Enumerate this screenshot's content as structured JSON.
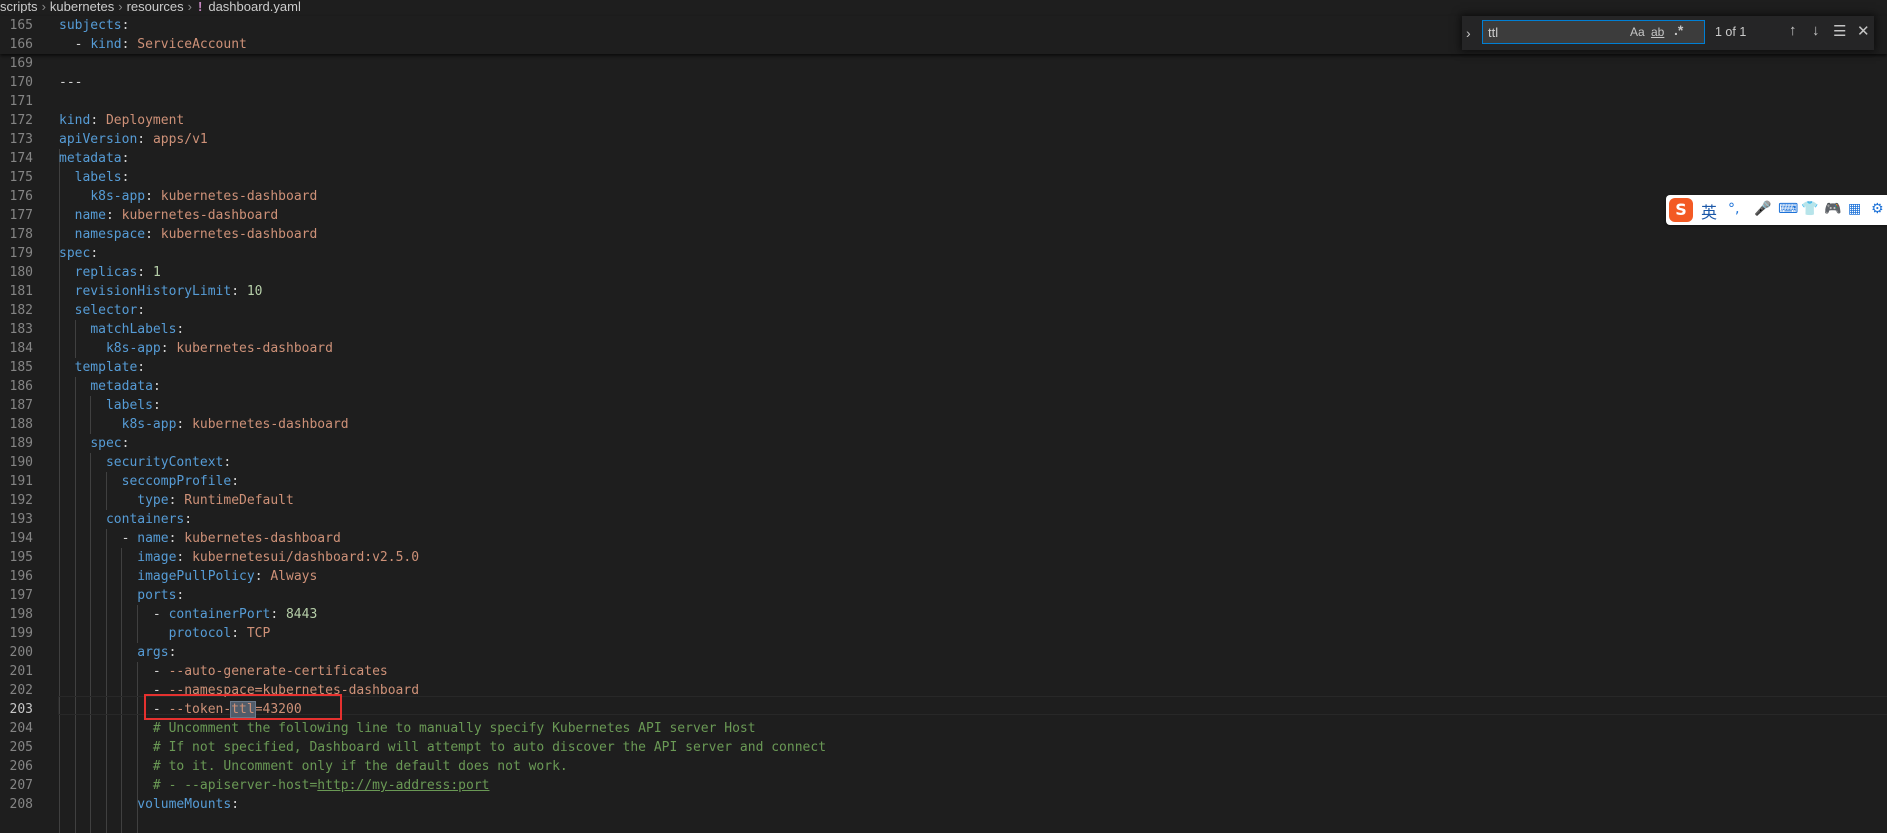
{
  "breadcrumb": {
    "parts": [
      "scripts",
      "kubernetes",
      "resources"
    ],
    "file_icon": "!",
    "file": "dashboard.yaml"
  },
  "find_widget": {
    "query": "ttl",
    "match_case_label": "Aa",
    "whole_word_label": "ab",
    "regex_label": ".*",
    "count": "1 of 1",
    "icons": [
      "chevron-right-icon",
      "arrow-up-icon",
      "arrow-down-icon",
      "find-in-selection-icon",
      "close-icon"
    ]
  },
  "ime_toolbar": {
    "logo": "S",
    "language": "英",
    "icons": [
      "punctuation-icon",
      "microphone-icon",
      "keyboard-icon",
      "skin-icon",
      "gamepad-icon",
      "grid-icon",
      "settings-icon"
    ]
  },
  "sticky": [
    {
      "num": "165",
      "tokens": [
        [
          "k",
          "subjects"
        ],
        [
          "p",
          ":"
        ]
      ]
    },
    {
      "num": "166",
      "tokens": [
        [
          "p",
          "  - "
        ],
        [
          "k",
          "kind"
        ],
        [
          "p",
          ": "
        ],
        [
          "s",
          "ServiceAccount"
        ]
      ]
    }
  ],
  "lines": [
    {
      "num": "169",
      "tokens": []
    },
    {
      "num": "170",
      "tokens": [
        [
          "p",
          "---"
        ]
      ]
    },
    {
      "num": "171",
      "tokens": []
    },
    {
      "num": "172",
      "tokens": [
        [
          "k",
          "kind"
        ],
        [
          "p",
          ": "
        ],
        [
          "s",
          "Deployment"
        ]
      ]
    },
    {
      "num": "173",
      "tokens": [
        [
          "k",
          "apiVersion"
        ],
        [
          "p",
          ": "
        ],
        [
          "s",
          "apps/v1"
        ]
      ]
    },
    {
      "num": "174",
      "tokens": [
        [
          "k",
          "metadata"
        ],
        [
          "p",
          ":"
        ]
      ]
    },
    {
      "num": "175",
      "tokens": [
        [
          "p",
          "  "
        ],
        [
          "k",
          "labels"
        ],
        [
          "p",
          ":"
        ]
      ]
    },
    {
      "num": "176",
      "tokens": [
        [
          "p",
          "    "
        ],
        [
          "k",
          "k8s-app"
        ],
        [
          "p",
          ": "
        ],
        [
          "s",
          "kubernetes-dashboard"
        ]
      ]
    },
    {
      "num": "177",
      "tokens": [
        [
          "p",
          "  "
        ],
        [
          "k",
          "name"
        ],
        [
          "p",
          ": "
        ],
        [
          "s",
          "kubernetes-dashboard"
        ]
      ]
    },
    {
      "num": "178",
      "tokens": [
        [
          "p",
          "  "
        ],
        [
          "k",
          "namespace"
        ],
        [
          "p",
          ": "
        ],
        [
          "s",
          "kubernetes-dashboard"
        ]
      ]
    },
    {
      "num": "179",
      "tokens": [
        [
          "k",
          "spec"
        ],
        [
          "p",
          ":"
        ]
      ]
    },
    {
      "num": "180",
      "tokens": [
        [
          "p",
          "  "
        ],
        [
          "k",
          "replicas"
        ],
        [
          "p",
          ": "
        ],
        [
          "n",
          "1"
        ]
      ]
    },
    {
      "num": "181",
      "tokens": [
        [
          "p",
          "  "
        ],
        [
          "k",
          "revisionHistoryLimit"
        ],
        [
          "p",
          ": "
        ],
        [
          "n",
          "10"
        ]
      ]
    },
    {
      "num": "182",
      "tokens": [
        [
          "p",
          "  "
        ],
        [
          "k",
          "selector"
        ],
        [
          "p",
          ":"
        ]
      ]
    },
    {
      "num": "183",
      "tokens": [
        [
          "p",
          "    "
        ],
        [
          "k",
          "matchLabels"
        ],
        [
          "p",
          ":"
        ]
      ]
    },
    {
      "num": "184",
      "tokens": [
        [
          "p",
          "      "
        ],
        [
          "k",
          "k8s-app"
        ],
        [
          "p",
          ": "
        ],
        [
          "s",
          "kubernetes-dashboard"
        ]
      ]
    },
    {
      "num": "185",
      "tokens": [
        [
          "p",
          "  "
        ],
        [
          "k",
          "template"
        ],
        [
          "p",
          ":"
        ]
      ]
    },
    {
      "num": "186",
      "tokens": [
        [
          "p",
          "    "
        ],
        [
          "k",
          "metadata"
        ],
        [
          "p",
          ":"
        ]
      ]
    },
    {
      "num": "187",
      "tokens": [
        [
          "p",
          "      "
        ],
        [
          "k",
          "labels"
        ],
        [
          "p",
          ":"
        ]
      ]
    },
    {
      "num": "188",
      "tokens": [
        [
          "p",
          "        "
        ],
        [
          "k",
          "k8s-app"
        ],
        [
          "p",
          ": "
        ],
        [
          "s",
          "kubernetes-dashboard"
        ]
      ]
    },
    {
      "num": "189",
      "tokens": [
        [
          "p",
          "    "
        ],
        [
          "k",
          "spec"
        ],
        [
          "p",
          ":"
        ]
      ]
    },
    {
      "num": "190",
      "tokens": [
        [
          "p",
          "      "
        ],
        [
          "k",
          "securityContext"
        ],
        [
          "p",
          ":"
        ]
      ]
    },
    {
      "num": "191",
      "tokens": [
        [
          "p",
          "        "
        ],
        [
          "k",
          "seccompProfile"
        ],
        [
          "p",
          ":"
        ]
      ]
    },
    {
      "num": "192",
      "tokens": [
        [
          "p",
          "          "
        ],
        [
          "k",
          "type"
        ],
        [
          "p",
          ": "
        ],
        [
          "s",
          "RuntimeDefault"
        ]
      ]
    },
    {
      "num": "193",
      "tokens": [
        [
          "p",
          "      "
        ],
        [
          "k",
          "containers"
        ],
        [
          "p",
          ":"
        ]
      ]
    },
    {
      "num": "194",
      "tokens": [
        [
          "p",
          "        - "
        ],
        [
          "k",
          "name"
        ],
        [
          "p",
          ": "
        ],
        [
          "s",
          "kubernetes-dashboard"
        ]
      ]
    },
    {
      "num": "195",
      "tokens": [
        [
          "p",
          "          "
        ],
        [
          "k",
          "image"
        ],
        [
          "p",
          ": "
        ],
        [
          "s",
          "kubernetesui/dashboard:v2.5.0"
        ]
      ]
    },
    {
      "num": "196",
      "tokens": [
        [
          "p",
          "          "
        ],
        [
          "k",
          "imagePullPolicy"
        ],
        [
          "p",
          ": "
        ],
        [
          "s",
          "Always"
        ]
      ]
    },
    {
      "num": "197",
      "tokens": [
        [
          "p",
          "          "
        ],
        [
          "k",
          "ports"
        ],
        [
          "p",
          ":"
        ]
      ]
    },
    {
      "num": "198",
      "tokens": [
        [
          "p",
          "            - "
        ],
        [
          "k",
          "containerPort"
        ],
        [
          "p",
          ": "
        ],
        [
          "n",
          "8443"
        ]
      ]
    },
    {
      "num": "199",
      "tokens": [
        [
          "p",
          "              "
        ],
        [
          "k",
          "protocol"
        ],
        [
          "p",
          ": "
        ],
        [
          "s",
          "TCP"
        ]
      ]
    },
    {
      "num": "200",
      "tokens": [
        [
          "p",
          "          "
        ],
        [
          "k",
          "args"
        ],
        [
          "p",
          ":"
        ]
      ]
    },
    {
      "num": "201",
      "tokens": [
        [
          "p",
          "            - "
        ],
        [
          "s",
          "--auto-generate-certificates"
        ]
      ]
    },
    {
      "num": "202",
      "tokens": [
        [
          "p",
          "            - "
        ],
        [
          "s",
          "--namespace=kubernetes-dashboard"
        ]
      ]
    },
    {
      "num": "203",
      "active": true,
      "tokens": [
        [
          "p",
          "            - "
        ],
        [
          "s",
          "--token-"
        ],
        [
          "m",
          "ttl"
        ],
        [
          "s",
          "=43200"
        ]
      ]
    },
    {
      "num": "204",
      "tokens": [
        [
          "p",
          "            "
        ],
        [
          "c",
          "# Uncomment the following line to manually specify Kubernetes API server Host"
        ]
      ]
    },
    {
      "num": "205",
      "tokens": [
        [
          "p",
          "            "
        ],
        [
          "c",
          "# If not specified, Dashboard will attempt to auto discover the API server and connect"
        ]
      ]
    },
    {
      "num": "206",
      "tokens": [
        [
          "p",
          "            "
        ],
        [
          "c",
          "# to it. Uncomment only if the default does not work."
        ]
      ]
    },
    {
      "num": "207",
      "tokens": [
        [
          "p",
          "            "
        ],
        [
          "c",
          "# - --apiserver-host="
        ],
        [
          "u",
          "http://my-address:port"
        ]
      ]
    },
    {
      "num": "208",
      "tokens": [
        [
          "p",
          "          "
        ],
        [
          "k",
          "volumeMounts"
        ],
        [
          "p",
          ":"
        ]
      ]
    }
  ]
}
